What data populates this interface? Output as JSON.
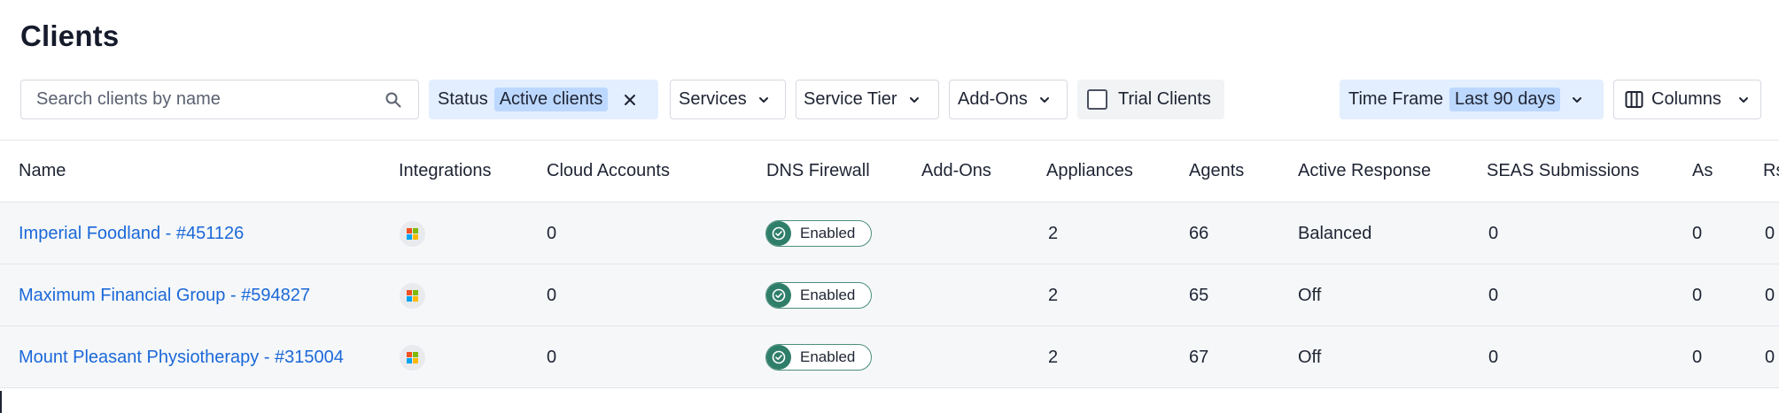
{
  "page": {
    "title": "Clients"
  },
  "search": {
    "placeholder": "Search clients by name",
    "icon": "search-icon"
  },
  "filters": {
    "status": {
      "label": "Status",
      "value": "Active clients"
    },
    "services": {
      "label": "Services"
    },
    "service_tier": {
      "label": "Service Tier"
    },
    "add_ons": {
      "label": "Add-Ons"
    },
    "trial": {
      "label": "Trial Clients",
      "checked": false
    },
    "time_frame": {
      "label": "Time Frame",
      "value": "Last 90 days"
    },
    "columns": {
      "label": "Columns"
    }
  },
  "table": {
    "headers": [
      "Name",
      "Integrations",
      "Cloud Accounts",
      "DNS Firewall",
      "Add-Ons",
      "Appliances",
      "Agents",
      "Active Response",
      "SEAS Submissions",
      "As",
      "Rs"
    ],
    "rows": [
      {
        "name": "Imperial Foodland - #451126",
        "integration": "microsoft-icon",
        "cloud_accounts": "0",
        "dns_firewall": "Enabled",
        "add_ons": "",
        "appliances": "2",
        "agents": "66",
        "active_response": "Balanced",
        "seas": "0",
        "as": "0",
        "rs": "0"
      },
      {
        "name": "Maximum Financial Group - #594827",
        "integration": "microsoft-icon",
        "cloud_accounts": "0",
        "dns_firewall": "Enabled",
        "add_ons": "",
        "appliances": "2",
        "agents": "65",
        "active_response": "Off",
        "seas": "0",
        "as": "0",
        "rs": "0"
      },
      {
        "name": "Mount Pleasant Physiotherapy - #315004",
        "integration": "microsoft-icon",
        "cloud_accounts": "0",
        "dns_firewall": "Enabled",
        "add_ons": "",
        "appliances": "2",
        "agents": "67",
        "active_response": "Off",
        "seas": "0",
        "as": "0",
        "rs": "0"
      }
    ]
  },
  "colors": {
    "link": "#1b68d8",
    "chip_blue": "#e3efff",
    "chip_value": "#bdd8ff",
    "toggle_on": "#2f7e69",
    "row_bg": "#f5f7f9"
  }
}
